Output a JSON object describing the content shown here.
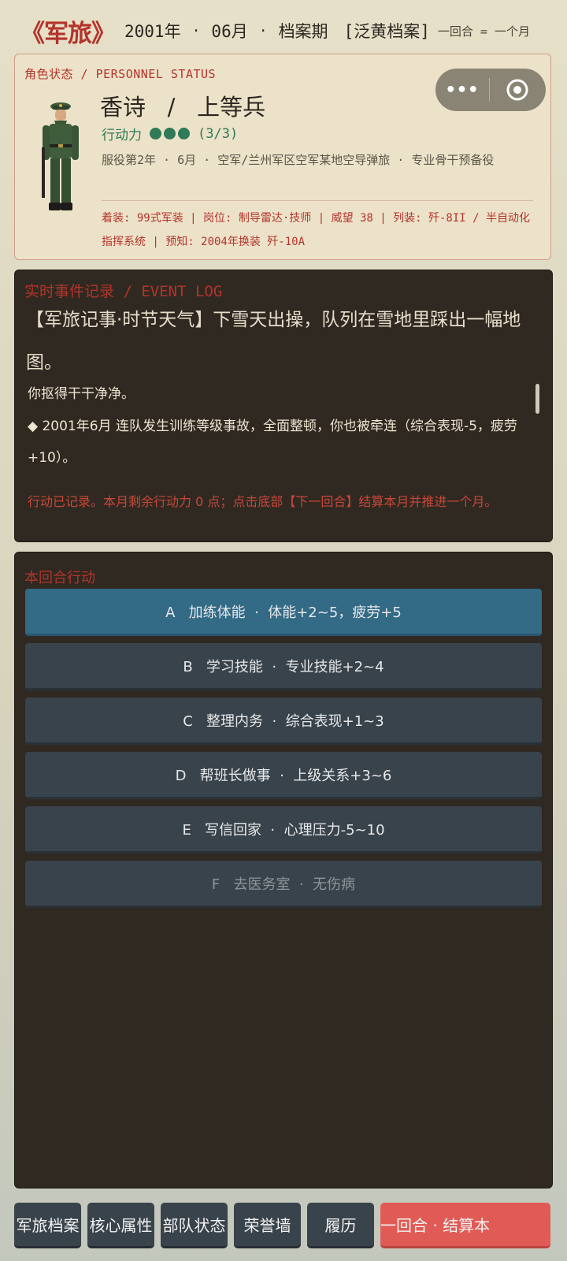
{
  "header": {
    "brand": "《军旅》",
    "year": "2001年",
    "month": "06月",
    "phase": "档案期",
    "tag": "[泛黄档案]",
    "turn_note": "一回合 = 一个月"
  },
  "personnel": {
    "section_label": "角色状态 / PERSONNEL STATUS",
    "name_rank": "香诗   /   上等兵",
    "action_points_label": "行动力",
    "action_points": {
      "current": 3,
      "max": 3,
      "text": "(3/3)"
    },
    "service_info": "服役第2年 · 6月 · 空军/兰州军区空军某地空导弹旅 · 专业骨干预备役",
    "equipment_info": "着装: 99式军装 | 岗位: 制导雷达·技师 | 威望 38 | 列装: 歼-8II / 半自动化指挥系统 | 预知: 2004年换装 歼-10A"
  },
  "capsule": {
    "more_label": "•••",
    "target_icon": "target-icon"
  },
  "event_log": {
    "section_label": "实时事件记录 / EVENT LOG",
    "headline": "【军旅记事·时节天气】下雪天出操，队列在雪地里踩出一幅地图。",
    "line1": "你抠得干干净净。",
    "line2": "◆ 2001年6月 连队发生训练等级事故，全面整顿，你也被牵连（综合表现-5，疲劳+10）。",
    "notice": "行动已记录。本月剩余行动力 0 点；点击底部【下一回合】结算本月并推进一个月。"
  },
  "actions": {
    "section_label": "本回合行动",
    "options": [
      {
        "text": "A   加练体能  ·  体能+2~5，疲劳+5",
        "state": "active"
      },
      {
        "text": "B   学习技能  ·  专业技能+2~4",
        "state": "normal"
      },
      {
        "text": "C   整理内务  ·  综合表现+1~3",
        "state": "normal"
      },
      {
        "text": "D   帮班长做事  ·  上级关系+3~6",
        "state": "normal"
      },
      {
        "text": "E   写信回家  ·  心理压力-5~10",
        "state": "normal"
      },
      {
        "text": "F   去医务室  ·  无伤病",
        "state": "disabled"
      }
    ]
  },
  "bottom_nav": {
    "files": "军旅档案",
    "attributes": "核心属性",
    "unit": "部队状态",
    "honor": "荣誉墙",
    "resume": "履历",
    "next_turn": "一回合  ·  结算本"
  },
  "colors": {
    "brand_red": "#b3342b",
    "panel_dark": "#302921",
    "option_active": "#336a86",
    "option": "#39434b",
    "next_button": "#e05b55",
    "ap_green": "#2f7a58"
  }
}
